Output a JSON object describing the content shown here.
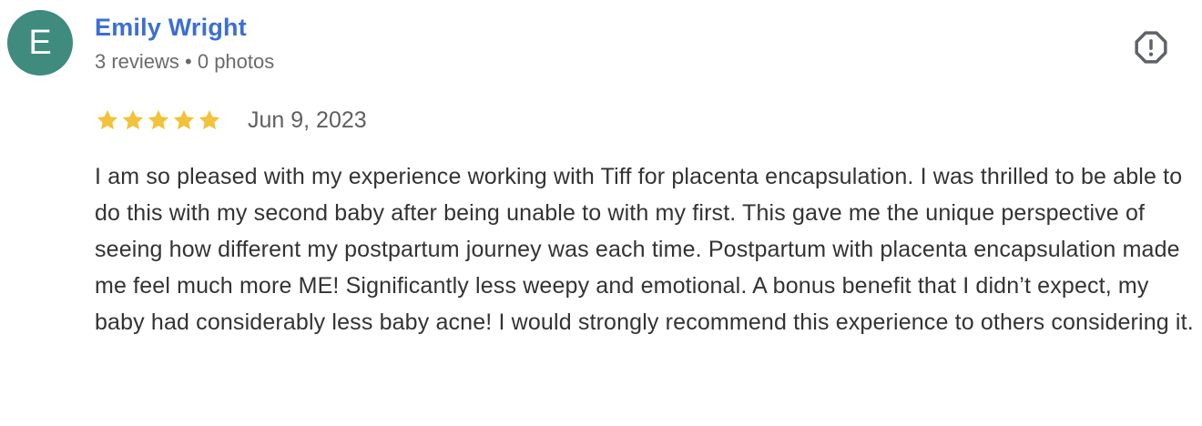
{
  "reviewer": {
    "initial": "E",
    "name": "Emily Wright",
    "meta": "3 reviews • 0 photos",
    "avatar_color": "#3f8b7d",
    "name_color": "#3b6fd4"
  },
  "report": {
    "icon": "report-flag-octagon-icon"
  },
  "review": {
    "rating": 5,
    "rating_max": 5,
    "star_color": "#f2c23a",
    "date": "Jun 9, 2023",
    "text": "I am so pleased with my experience working with Tiff for placenta encapsulation. I was thrilled to be able to do this with my second baby after being unable to with my first. This gave me the unique perspective of seeing how different my postpartum journey was each time. Postpartum with placenta encapsulation made me feel much more ME! Significantly less weepy and emotional. A bonus benefit that I didn’t expect, my baby had considerably less baby acne! I would strongly recommend this experience to others considering it."
  }
}
